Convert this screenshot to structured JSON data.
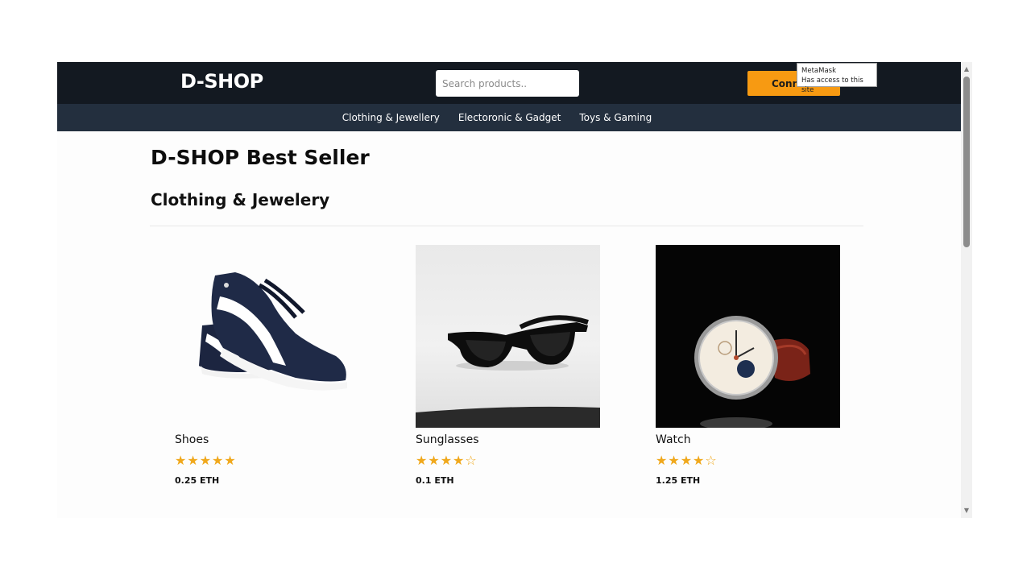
{
  "header": {
    "logo": "D-SHOP",
    "search_placeholder": "Search products..",
    "connect_label": "Conn"
  },
  "nav": {
    "items": [
      "Clothing & Jewellery",
      "Electoronic & Gadget",
      "Toys & Gaming"
    ]
  },
  "tooltip": {
    "title": "MetaMask",
    "text": "Has access to this site"
  },
  "main": {
    "title": "D-SHOP Best Seller",
    "section": "Clothing & Jewelery",
    "products": [
      {
        "name": "Shoes",
        "rating": 5,
        "price": "0.25 ETH",
        "image": "sneaker-photo"
      },
      {
        "name": "Sunglasses",
        "rating": 4,
        "price": "0.1 ETH",
        "image": "sunglasses-photo"
      },
      {
        "name": "Watch",
        "rating": 4,
        "price": "1.25 ETH",
        "image": "watch-photo"
      }
    ]
  },
  "colors": {
    "topbar": "#131921",
    "subnav": "#232f3e",
    "accent": "#f79a12",
    "star": "#f0a81c"
  }
}
